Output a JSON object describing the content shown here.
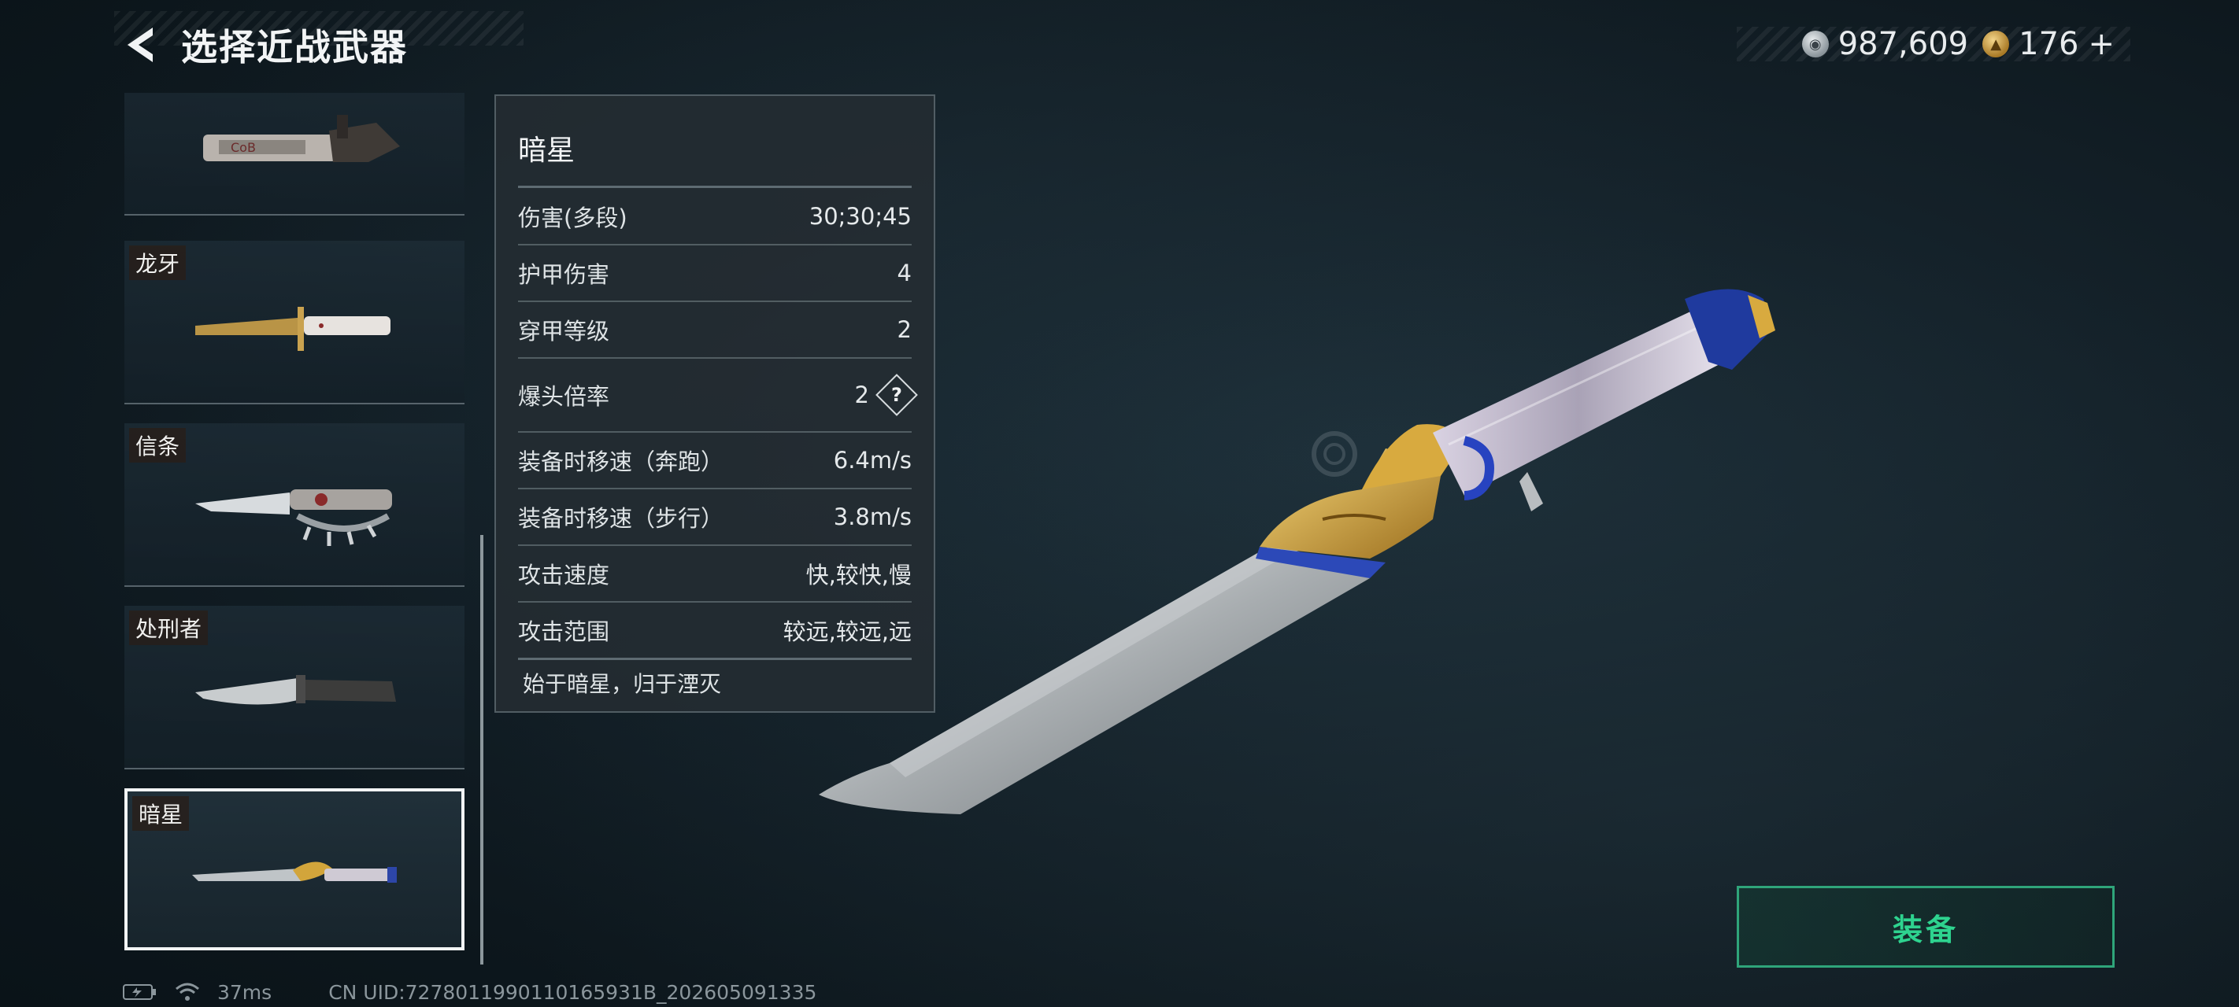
{
  "header": {
    "title": "选择近战武器"
  },
  "currency": {
    "silver": "987,609",
    "gold": "176",
    "gold_add": "+"
  },
  "weapons": [
    {
      "name": ""
    },
    {
      "name": "龙牙"
    },
    {
      "name": "信条"
    },
    {
      "name": "处刑者"
    },
    {
      "name": "暗星"
    }
  ],
  "detail": {
    "name": "暗星",
    "stats": [
      {
        "label": "伤害(多段)",
        "value": "30;30;45"
      },
      {
        "label": "护甲伤害",
        "value": "4"
      },
      {
        "label": "穿甲等级",
        "value": "2"
      },
      {
        "label": "爆头倍率",
        "value": "2"
      },
      {
        "label": "装备时移速（奔跑）",
        "value": "6.4m/s"
      },
      {
        "label": "装备时移速（步行）",
        "value": "3.8m/s"
      },
      {
        "label": "攻击速度",
        "value": "快,较快,慢"
      },
      {
        "label": "攻击范围",
        "value": "较远,较远,远"
      }
    ],
    "help_symbol": "?",
    "description": "始于暗星，归于湮灭"
  },
  "equip": {
    "label": "装备"
  },
  "footer": {
    "ping": "37ms",
    "uid": "CN UID:7278011990110165931B_202605091335"
  },
  "colors": {
    "accent_green": "#2ed38f",
    "selected_border": "#f2f4f5"
  },
  "icons": [
    "back-arrow-icon",
    "silver-coin-icon",
    "gold-coin-icon",
    "battery-icon",
    "wifi-icon",
    "help-icon"
  ]
}
